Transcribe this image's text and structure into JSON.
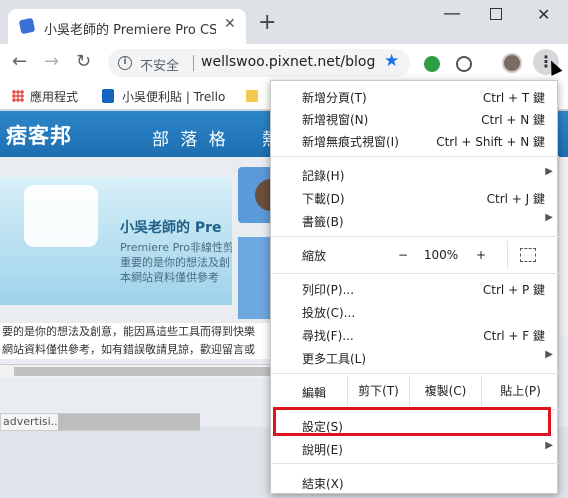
{
  "tab": {
    "title": "小吳老師的 Premiere Pro CS x 剪"
  },
  "toolbar": {
    "security_label": "不安全",
    "url": "wellswoo.pixnet.net/blog"
  },
  "bookmarks": [
    {
      "label": "應用程式",
      "icon": "apps-grid-icon"
    },
    {
      "label": "小吳便利貼 | Trello",
      "icon": "trello-icon"
    }
  ],
  "blog": {
    "logo": "痞客邦",
    "nav_item": "部 落 格",
    "nav_item2": "熱",
    "banner_title": "小吳老師的 Pre",
    "banner_line1": "Premiere Pro非線性剪",
    "banner_line2": "重要的是你的想法及創",
    "banner_line3": "本網站資料僅供參考",
    "text_line1": "要的是你的想法及創意，能因爲這些工具而得到快樂",
    "text_line2": "網站資料僅供參考，如有錯誤敬請見諒，歡迎留言或",
    "status": "advertisi..."
  },
  "menu": {
    "new_tab": {
      "label": "新增分頁(T)",
      "shortcut": "Ctrl + T 鍵"
    },
    "new_window": {
      "label": "新增視窗(N)",
      "shortcut": "Ctrl + N 鍵"
    },
    "new_incognito": {
      "label": "新增無痕式視窗(I)",
      "shortcut": "Ctrl + Shift + N 鍵"
    },
    "history": {
      "label": "記錄(H)"
    },
    "downloads": {
      "label": "下載(D)",
      "shortcut": "Ctrl + J 鍵"
    },
    "bookmarks": {
      "label": "書籤(B)"
    },
    "zoom": {
      "label": "縮放",
      "minus": "−",
      "value": "100%",
      "plus": "+"
    },
    "print": {
      "label": "列印(P)...",
      "shortcut": "Ctrl + P 鍵"
    },
    "cast": {
      "label": "投放(C)..."
    },
    "find": {
      "label": "尋找(F)...",
      "shortcut": "Ctrl + F 鍵"
    },
    "more_tools": {
      "label": "更多工具(L)"
    },
    "edit": {
      "label": "編輯",
      "cut": "剪下(T)",
      "copy": "複製(C)",
      "paste": "貼上(P)"
    },
    "settings": {
      "label": "設定(S)"
    },
    "help": {
      "label": "說明(E)"
    },
    "exit": {
      "label": "結束(X)"
    }
  },
  "colors": {
    "highlight": "#e0141e",
    "accent": "#1a73e8",
    "blog_header": "#1d6eb0"
  }
}
